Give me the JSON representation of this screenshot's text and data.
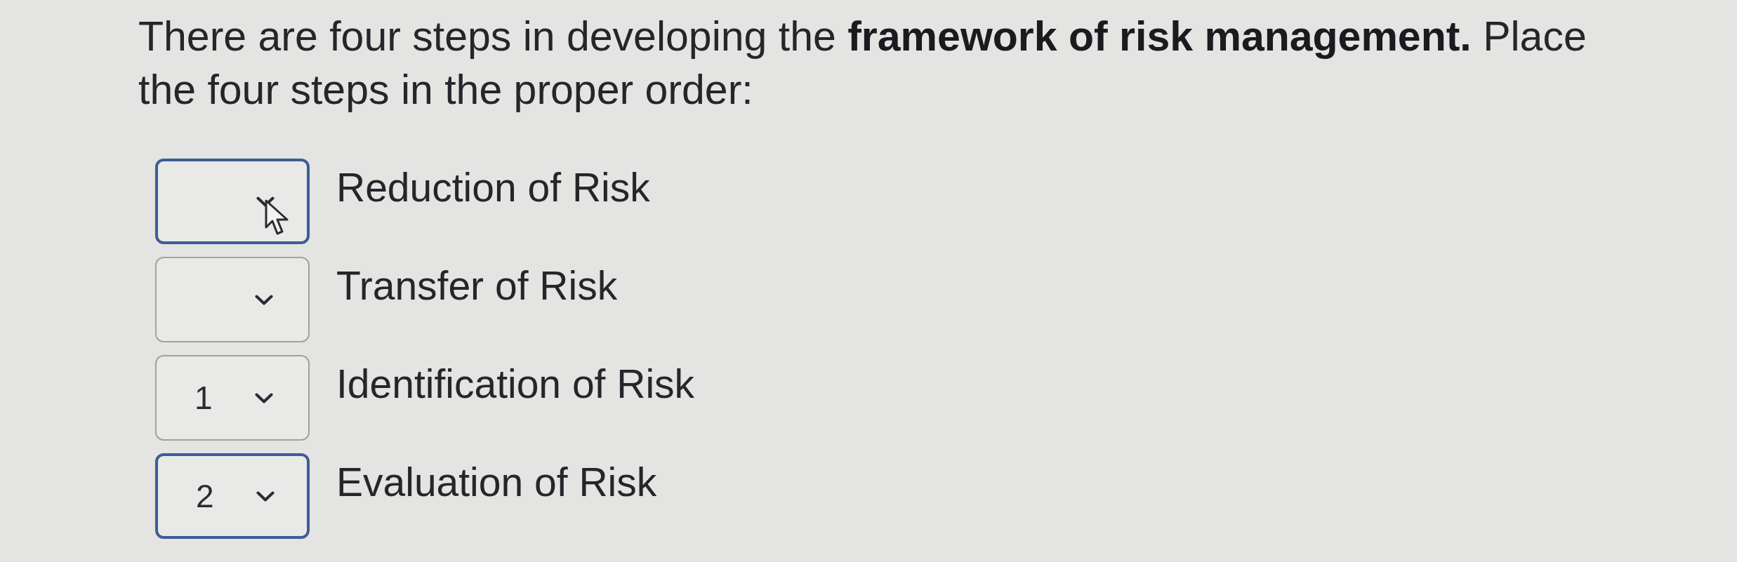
{
  "question": "There are four steps in developing the **framework of risk management.** Place the four steps in the proper order:",
  "items": [
    {
      "label": "Reduction of Risk",
      "highlighted": true,
      "hovered": true
    },
    {
      "label": "Transfer of Risk",
      "highlighted": false,
      "hovered": false
    },
    {
      "label": "Identification of Risk",
      "value": "1",
      "highlighted": false,
      "hovered": false
    },
    {
      "label": "Evaluation of Risk",
      "value": "2",
      "highlighted": true,
      "hovered": false
    }
  ]
}
